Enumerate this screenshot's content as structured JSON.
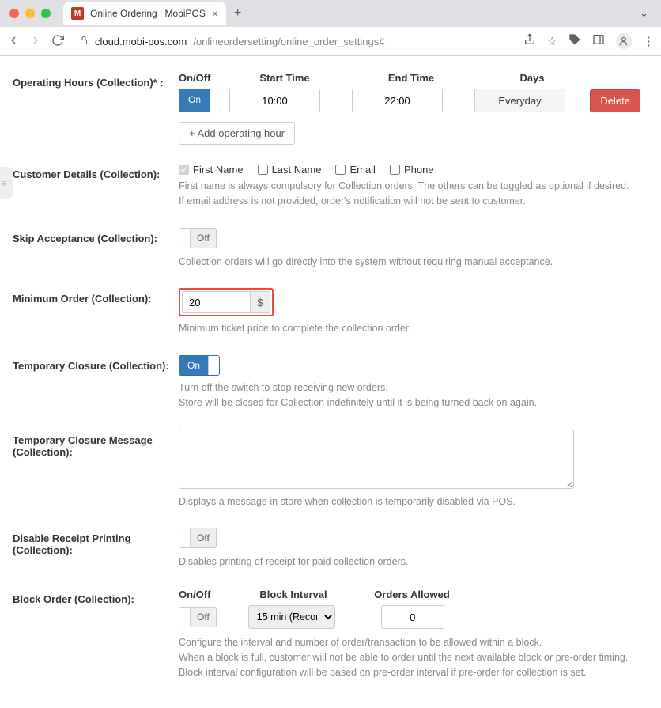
{
  "browser": {
    "tab_title": "Online Ordering | MobiPOS",
    "favicon_letter": "M",
    "url_host": "cloud.mobi-pos.com",
    "url_path": "/onlineordersetting/online_order_settings#"
  },
  "operating_hours": {
    "label": "Operating Hours (Collection)* :",
    "head_onoff": "On/Off",
    "head_start": "Start Time",
    "head_end": "End Time",
    "head_days": "Days",
    "on_label": "On",
    "start_value": "10:00",
    "end_value": "22:00",
    "days_value": "Everyday",
    "delete_label": "Delete",
    "add_label": "+ Add operating hour"
  },
  "customer_details": {
    "label": "Customer Details (Collection):",
    "first_name": "First Name",
    "last_name": "Last Name",
    "email": "Email",
    "phone": "Phone",
    "help1": "First name is always compulsory for Collection orders. The others can be toggled as optional if desired.",
    "help2": "If email address is not provided, order's notification will not be sent to customer."
  },
  "skip_acceptance": {
    "label": "Skip Acceptance (Collection):",
    "off": "Off",
    "help": "Collection orders will go directly into the system without requiring manual acceptance."
  },
  "minimum_order": {
    "label": "Minimum Order (Collection):",
    "value": "20",
    "currency": "$",
    "help": "Minimum ticket price to complete the collection order."
  },
  "temp_closure": {
    "label": "Temporary Closure (Collection):",
    "on": "On",
    "help1": "Turn off the switch to stop receiving new orders.",
    "help2": "Store will be closed for Collection indefinitely until it is being turned back on again."
  },
  "temp_msg": {
    "label": "Temporary Closure Message (Collection):",
    "help": "Displays a message in store when collection is temporarily disabled via POS."
  },
  "disable_receipt": {
    "label": "Disable Receipt Printing (Collection):",
    "off": "Off",
    "help": "Disables printing of receipt for paid collection orders."
  },
  "block_order": {
    "label": "Block Order (Collection):",
    "head_onoff": "On/Off",
    "head_interval": "Block Interval",
    "head_orders": "Orders Allowed",
    "off": "Off",
    "interval_value": "15 min (Recom",
    "orders_value": "0",
    "help1": "Configure the interval and number of order/transaction to be allowed within a block.",
    "help2": "When a block is full, customer will not be able to order until the next available block or pre-order timing.",
    "help3": "Block interval configuration will be based on pre-order interval if pre-order for collection is set."
  }
}
